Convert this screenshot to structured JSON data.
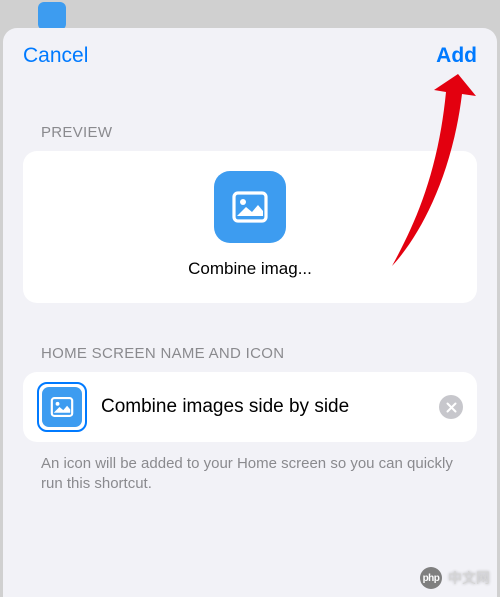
{
  "nav": {
    "cancel_label": "Cancel",
    "add_label": "Add"
  },
  "preview": {
    "section_label": "PREVIEW",
    "app_name": "Combine imag..."
  },
  "name_section": {
    "section_label": "HOME SCREEN NAME AND ICON",
    "input_value": "Combine images side by side",
    "footer_text": "An icon will be added to your Home screen so you can quickly run this shortcut."
  },
  "watermark": {
    "logo_text": "php",
    "site_text": "中文网"
  }
}
